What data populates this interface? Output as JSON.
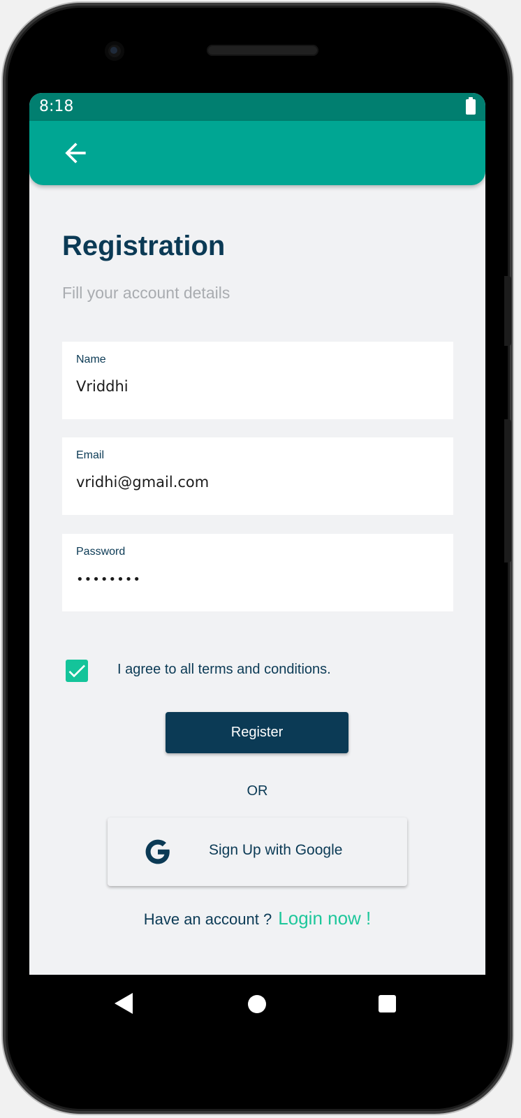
{
  "status_bar": {
    "time": "8:18",
    "icons": [
      "battery-icon"
    ]
  },
  "app_bar": {
    "back_icon": "arrow-back-icon"
  },
  "page": {
    "title": "Registration",
    "subtitle": "Fill your account details"
  },
  "form": {
    "name": {
      "label": "Name",
      "value": "Vriddhi"
    },
    "email": {
      "label": "Email",
      "value": "vridhi@gmail.com"
    },
    "password": {
      "label": "Password",
      "value": "••••••••"
    }
  },
  "terms": {
    "checked": true,
    "text": "I agree to all terms and conditions."
  },
  "actions": {
    "register_label": "Register",
    "or_text": "OR",
    "google_label": "Sign Up with Google",
    "google_icon": "google-icon"
  },
  "login": {
    "prompt": "Have an account ?",
    "link": "Login now !"
  },
  "colors": {
    "status_bar": "#017f70",
    "app_bar": "#00a693",
    "primary_text": "#0b3a55",
    "accent": "#1ec79b",
    "checkbox": "#14c49a",
    "background": "#f1f2f4"
  },
  "nav_bar": {
    "icons": [
      "nav-back-icon",
      "nav-home-icon",
      "nav-recents-icon"
    ]
  }
}
